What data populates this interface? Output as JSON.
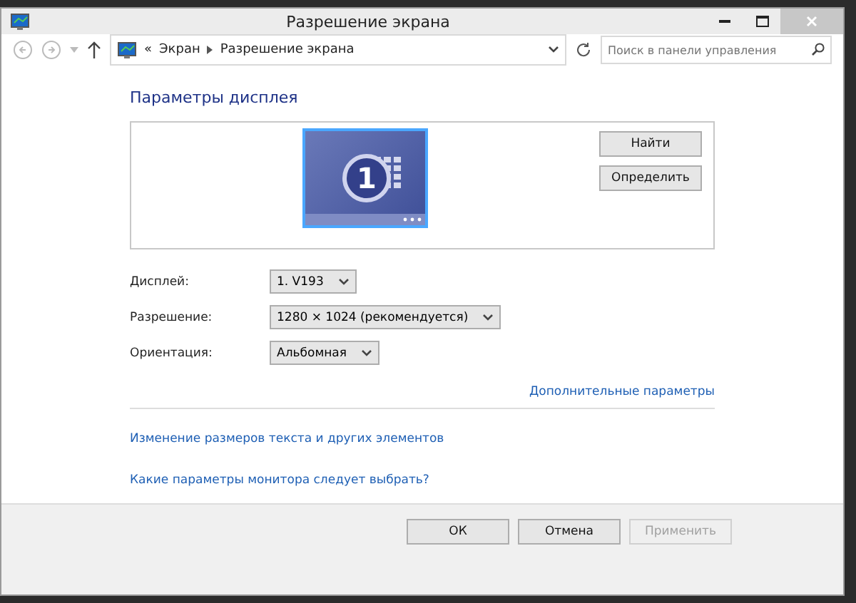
{
  "window": {
    "title": "Разрешение экрана"
  },
  "address": {
    "prefix": "«",
    "crumbs": [
      "Экран",
      "Разрешение экрана"
    ]
  },
  "search": {
    "placeholder": "Поиск в панели управления"
  },
  "heading": "Параметры дисплея",
  "monitor": {
    "number": "1",
    "selected": true
  },
  "side_buttons": [
    "Найти",
    "Определить"
  ],
  "fields": [
    {
      "label": "Дисплей:",
      "value": "1. V193"
    },
    {
      "label": "Разрешение:",
      "value": "1280 × 1024 (рекомендуется)"
    },
    {
      "label": "Ориентация:",
      "value": "Альбомная"
    }
  ],
  "advanced_link": "Дополнительные параметры",
  "links": [
    "Изменение размеров текста и других элементов",
    "Какие параметры монитора следует выбрать?"
  ],
  "buttons": [
    {
      "label": "ОК",
      "disabled": false
    },
    {
      "label": "Отмена",
      "disabled": false
    },
    {
      "label": "Применить",
      "disabled": true
    }
  ]
}
